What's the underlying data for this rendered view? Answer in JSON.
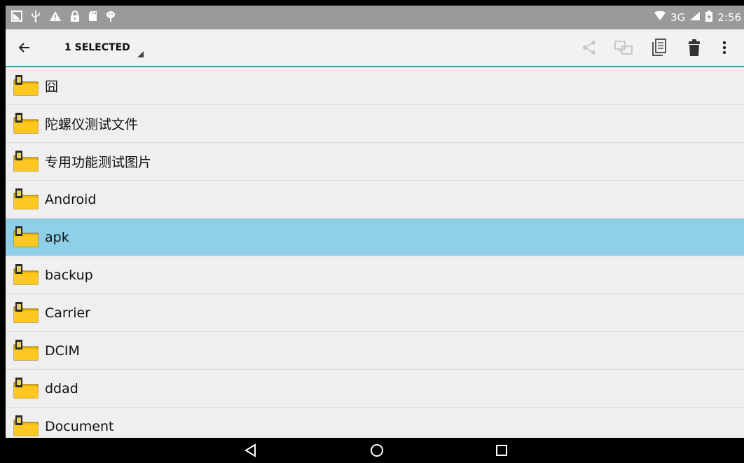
{
  "status_bar": {
    "left_icons": [
      "screenshot-icon",
      "usb-icon",
      "warning-icon",
      "lock-icon",
      "sd-card-icon",
      "android-debug-icon"
    ],
    "network": "3G",
    "time": "2:56"
  },
  "action_bar": {
    "selection_label": "1 SELECTED",
    "icons": [
      "back-arrow-icon",
      "share-icon",
      "move-icon",
      "copy-icon",
      "delete-icon",
      "more-vert-icon"
    ]
  },
  "files": [
    {
      "name": "囧",
      "selected": false
    },
    {
      "name": "陀螺仪测试文件",
      "selected": false
    },
    {
      "name": "专用功能测试图片",
      "selected": false
    },
    {
      "name": "Android",
      "selected": false
    },
    {
      "name": "apk",
      "selected": true
    },
    {
      "name": "backup",
      "selected": false
    },
    {
      "name": "Carrier",
      "selected": false
    },
    {
      "name": "DCIM",
      "selected": false
    },
    {
      "name": "ddad",
      "selected": false
    },
    {
      "name": "Document",
      "selected": false
    }
  ],
  "colors": {
    "status_bar": "#9a9a9a",
    "action_bar": "#f2f2f2",
    "accent_line": "#3a9a96",
    "selected_row": "#8fd0e8",
    "folder": "#f5b800"
  }
}
